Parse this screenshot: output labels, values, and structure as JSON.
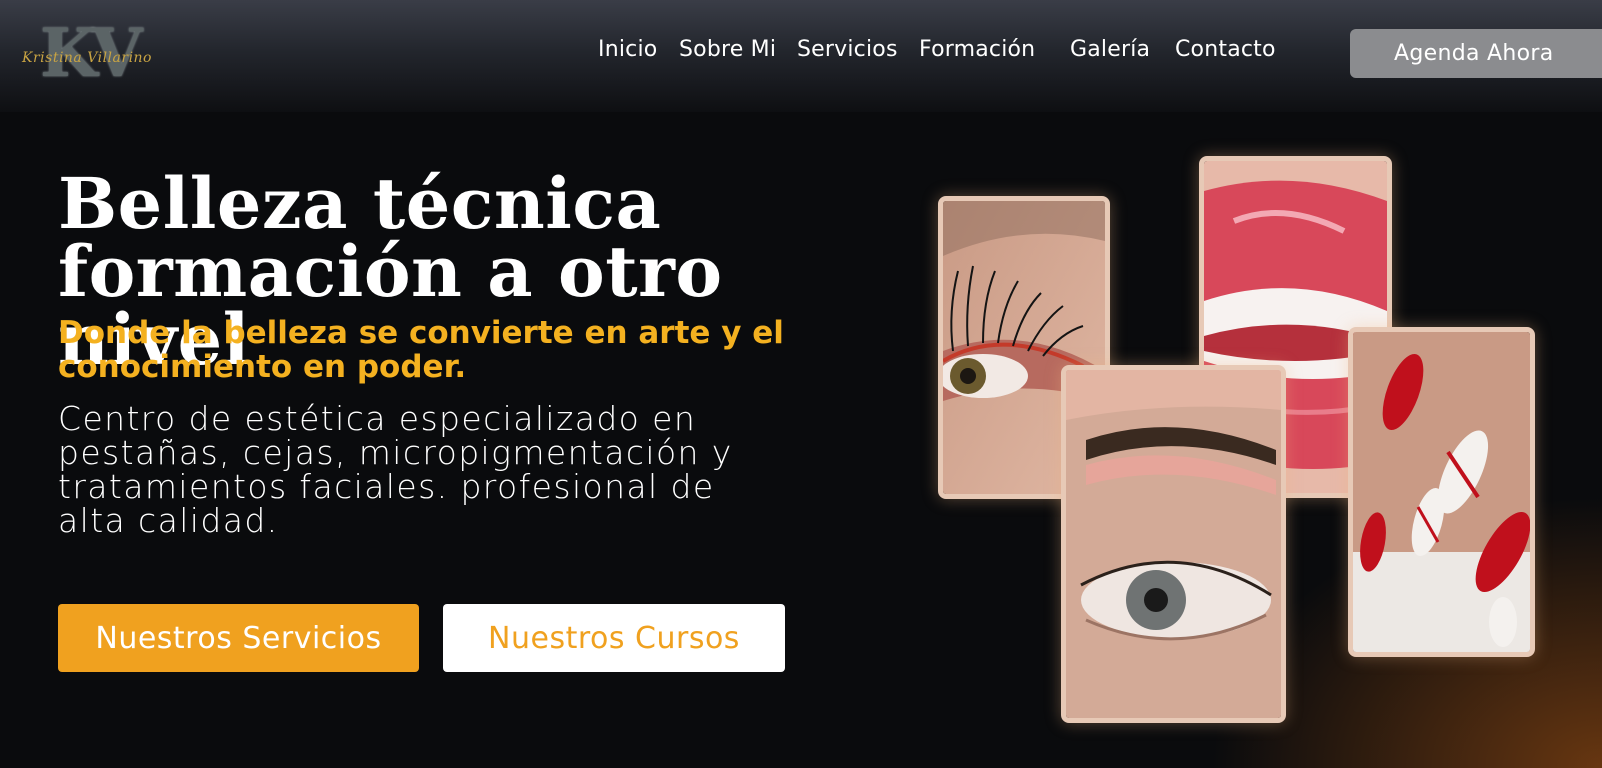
{
  "brand": {
    "monogram": "KV",
    "script_name": "Kristina Villarino"
  },
  "nav": {
    "items": [
      {
        "label": "Inicio"
      },
      {
        "label": "Sobre Mi"
      },
      {
        "label": "Servicios"
      },
      {
        "label": "Formación"
      },
      {
        "label": "Galería"
      },
      {
        "label": "Contacto"
      }
    ],
    "cta_label": "Agenda Ahora"
  },
  "hero": {
    "title_line1": "Belleza técnica",
    "title_line2": "formación a otro nivel",
    "subtitle": "Donde la belleza se convierte en arte y el conocimiento en poder.",
    "description": "Centro de estética especializado en pestañas, cejas, micropigmentación y tratamientos faciales. profesional de alta calidad.",
    "primary_button": "Nuestros Servicios",
    "secondary_button": "Nuestros Cursos"
  },
  "colors": {
    "accent": "#f0a11f",
    "background": "#0a0b0d",
    "header_gradient_top": "#3a3d47",
    "photo_border": "#e7c9b6"
  }
}
